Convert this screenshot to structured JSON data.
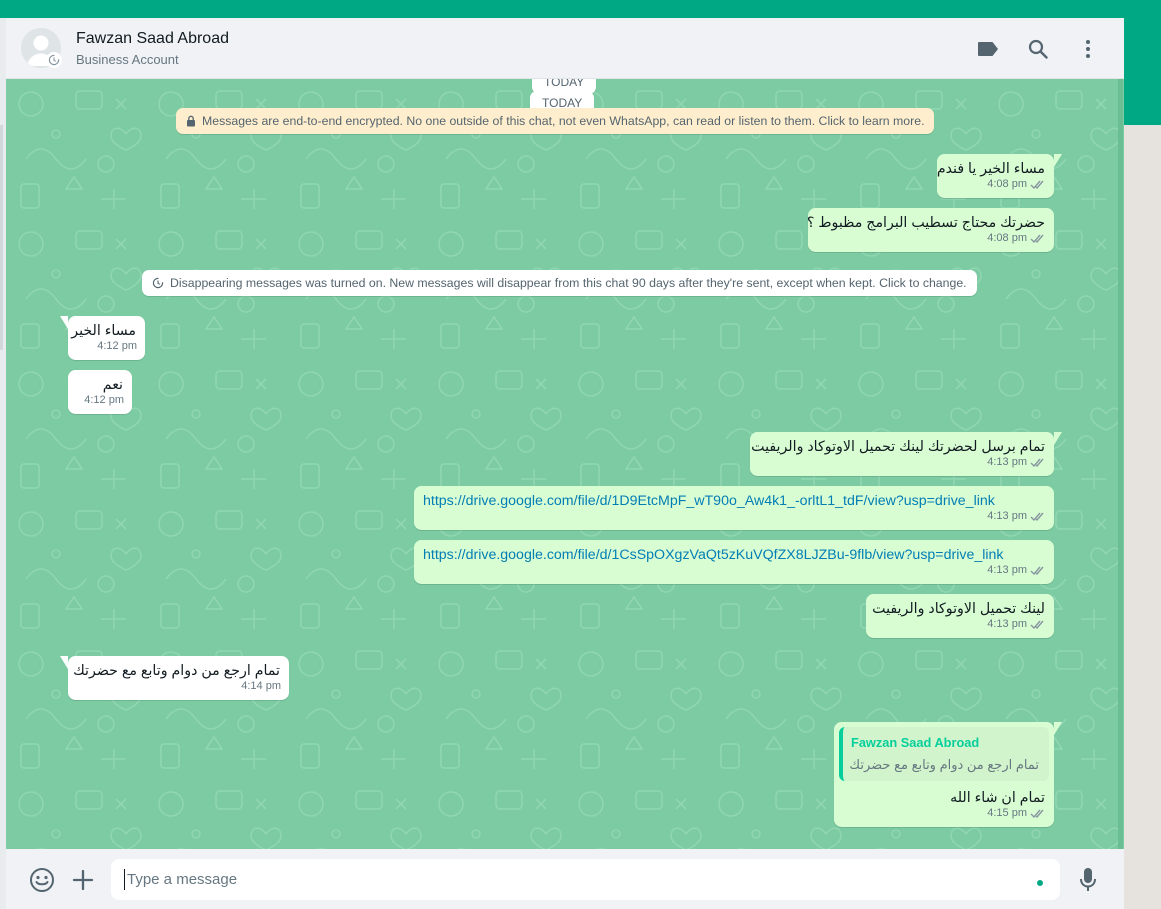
{
  "colors": {
    "brand": "#00a884",
    "chat_bg": "#7ccba2",
    "outgoing_bubble": "#d9fdd3",
    "incoming_bubble": "#ffffff",
    "encryption_notice": "#ffeecd",
    "quote_accent": "#06cf9c",
    "link": "#027eb5"
  },
  "header": {
    "contact_name": "Fawzan Saad Abroad",
    "subtitle": "Business Account",
    "icons": [
      "label-icon",
      "search-icon",
      "menu-icon"
    ]
  },
  "chat": {
    "date_chip_partial": "TODAY",
    "date_chip": "TODAY",
    "encryption_notice": "Messages are end-to-end encrypted. No one outside of this chat, not even WhatsApp, can read or listen to them. Click to learn more.",
    "disappearing_notice": "Disappearing messages was turned on. New messages will disappear from this chat 90 days after they're sent, except when kept. Click to change.",
    "messages": [
      {
        "direction": "out",
        "text": "مساء الخير يا فندم",
        "time": "4:08 pm",
        "status": "read"
      },
      {
        "direction": "out",
        "text": "حضرتك محتاج تسطيب البرامج مظبوط ؟",
        "time": "4:08 pm",
        "status": "read"
      },
      {
        "direction": "in",
        "text": "مساء الخير",
        "time": "4:12 pm"
      },
      {
        "direction": "in",
        "text": "نعم",
        "time": "4:12 pm"
      },
      {
        "direction": "out",
        "text": "تمام برسل لحضرتك لينك تحميل الاوتوكاد والريفيت",
        "time": "4:13 pm",
        "status": "read"
      },
      {
        "direction": "out",
        "text": "https://drive.google.com/file/d/1D9EtcMpF_wT90o_Aw4k1_-orltL1_tdF/view?usp=drive_link",
        "time": "4:13 pm",
        "status": "read"
      },
      {
        "direction": "out",
        "text": "https://drive.google.com/file/d/1CsSpOXgzVaQt5zKuVQfZX8LJZBu-9flb/view?usp=drive_link",
        "time": "4:13 pm",
        "status": "read"
      },
      {
        "direction": "out",
        "text": "لينك تحميل الاوتوكاد والريفيت",
        "time": "4:13 pm",
        "status": "read"
      },
      {
        "direction": "in",
        "text": "تمام ارجع من دوام وتابع مع حضرتك",
        "time": "4:14 pm"
      },
      {
        "direction": "out",
        "quote_name": "Fawzan Saad Abroad",
        "quote_text": "تمام ارجع من دوام وتابع مع حضرتك",
        "text": "تمام ان شاء الله",
        "time": "4:15 pm",
        "status": "read"
      }
    ]
  },
  "footer": {
    "input_placeholder": "Type a message",
    "icons": [
      "emoji-icon",
      "plus-icon",
      "microphone-icon"
    ]
  }
}
